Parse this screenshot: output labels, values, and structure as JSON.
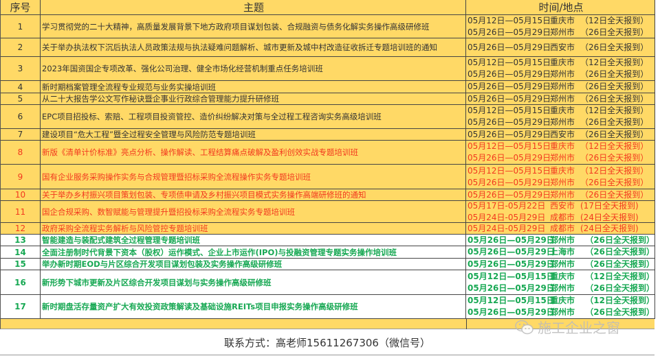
{
  "header": {
    "seq": "序号",
    "topic": "主题",
    "time": "时间/地点"
  },
  "rows": [
    {
      "no": "1",
      "style": "dark",
      "topic": "学习贯彻党的二十大精神，高质量发展背景下地方政府项目谋划包装、合规融资与债务化解实务操作高级研修班",
      "sessions": [
        {
          "date": "05月12日—05月15日",
          "city": "重庆市",
          "note": "（12日全天报到）"
        },
        {
          "date": "05月26日—05月29日",
          "city": "郑州市",
          "note": "（26日全天报到）"
        }
      ]
    },
    {
      "no": "2",
      "style": "dark",
      "topic": "关于举办执法权下沉后执法人员政策法规与执法疑难问题解析、城市更新及城中村改造征收拆迁专题培训班的通知",
      "sessions": [
        {
          "date": "05月26日—05月29日",
          "city": "西安市",
          "note": "（26日全天报到）"
        }
      ]
    },
    {
      "no": "3",
      "style": "dark",
      "topic": "2023年国资国企专项改革、强化公司治理、健全市场化经营机制重点任务培训班",
      "sessions": [
        {
          "date": "05月12日—05月15日",
          "city": "重庆市",
          "note": "（12日全天报到）"
        },
        {
          "date": "05月26日—05月29日",
          "city": "郑州市",
          "note": "（26日全天报到）"
        }
      ]
    },
    {
      "no": "4",
      "style": "dark",
      "topic": "新时期档案管理全流程专业规范与业务实操培训班",
      "sessions": [
        {
          "date": "05月26日—05月29日",
          "city": "郑州市",
          "note": "（26日全天报到）"
        }
      ]
    },
    {
      "no": "5",
      "style": "dark",
      "topic": "从二十大报告学公文写作秘诀暨企事业行政综合管理能力提升研修班",
      "sessions": [
        {
          "date": "05月26日—05月29日",
          "city": "郑州市",
          "note": "（26日全天报到）"
        }
      ]
    },
    {
      "no": "6",
      "style": "dark",
      "topic": "EPC项目招投标、索赔、工程项目投资管控、造价纠纷解决对策与全过程工程咨询实务高级培训班",
      "sessions": [
        {
          "date": "05月12日—05月15日",
          "city": "重庆市",
          "note": "（12日全天报到）"
        },
        {
          "date": "05月26日—05月29日",
          "city": "郑州市",
          "note": "（26日全天报到）"
        }
      ]
    },
    {
      "no": "7",
      "style": "dark",
      "topic": "建设项目“危大工程”暨全过程安全管理与风险防范专题培训班",
      "sessions": [
        {
          "date": "05月26日—05月29日",
          "city": "西安市",
          "note": "（26日全天报到）"
        }
      ]
    },
    {
      "no": "8",
      "style": "red",
      "topic": "新版《清单计价标准》亮点分析、操作解读、工程结算痛点破解及盈利创效实战专题培训班",
      "sessions": [
        {
          "date": "05月12日—05月15日",
          "city": "重庆市",
          "note": "（12日全天报到）"
        },
        {
          "date": "05月26日—05月29日",
          "city": "郑州市",
          "note": "（26日全天报到）"
        }
      ]
    },
    {
      "no": "9",
      "style": "red",
      "topic": "国有企业服务采购操作实务与合规管理暨招标采购全流程操作实务专题培训班",
      "sessions": [
        {
          "date": "05月12日—05月15日",
          "city": "重庆市",
          "note": "（12日全天报到）"
        },
        {
          "date": "05月26日—05月29日",
          "city": "郑州市",
          "note": "（26日全天报到）"
        }
      ]
    },
    {
      "no": "10",
      "style": "red",
      "topic": "关于举办乡村振兴项目策划包装、专项债申请及乡村振兴项目模式实务操作高端研修班的通知",
      "sessions": [
        {
          "date": "05月26日—05月29日",
          "city": "郑州市",
          "note": "（26日全天报到）"
        }
      ]
    },
    {
      "no": "11",
      "style": "red",
      "topic": "国企合规采购、数智赋能与管理提升暨招投标采购全流程实务专题培训班",
      "sessions": [
        {
          "date": "05月17日-05月22日",
          "city": "西安市",
          "note": "(17日全天报到)"
        },
        {
          "date": "05月24日-05月29日",
          "city": "成都市",
          "note": "(24日全天报到)"
        }
      ]
    },
    {
      "no": "12",
      "style": "red",
      "topic": "政府采购全流程实务解析与风险管控专题培训班",
      "sessions": [
        {
          "date": "05月24日-05月29日",
          "city": "成都市",
          "note": "(24日全天报到)"
        }
      ]
    },
    {
      "no": "13",
      "style": "green",
      "topic": "智能建造与装配式建筑全过程管理专题培训班",
      "sessions": [
        {
          "date": "05月26日—05月29日",
          "city": "郑州市",
          "note": "（26日全天报到）"
        }
      ]
    },
    {
      "no": "14",
      "style": "green",
      "topic": "全面注册制时代背景下资本（股权）运作模式、企业上市运作(IPO)与投融资管理专题实务操作培训班",
      "sessions": [
        {
          "date": "05月26日—05月29日",
          "city": "上海市",
          "note": "（26日全天报到）"
        }
      ]
    },
    {
      "no": "15",
      "style": "green",
      "topic": "举办新时期EOD与片区综合开发项目谋划包装及实务操作高级研修班",
      "sessions": [
        {
          "date": "05月26日—05月29日",
          "city": "郑州市",
          "note": "（26日全天报到）"
        }
      ]
    },
    {
      "no": "16",
      "style": "green",
      "topic": "新形势下城市更新及片区综合开发项目谋划与实务操作高级研修班",
      "sessions": [
        {
          "date": "05月12日—05月15日",
          "city": "重庆市",
          "note": "（12日全天报到）"
        },
        {
          "date": "05月26日—05月29日",
          "city": "郑州市",
          "note": "（26日全天报到）"
        }
      ]
    },
    {
      "no": "17",
      "style": "green",
      "topic": "新时期盘活存量资产扩大有效投资政策解读及基础设施REITs项目申报实务操作高级研修班",
      "sessions": [
        {
          "date": "05月12日—05月15日",
          "city": "重庆市",
          "note": "（12日全天报到）"
        },
        {
          "date": "05月26日—05月29日",
          "city": "郑州市",
          "note": "（26日全天报到）"
        }
      ]
    }
  ],
  "footer": {
    "contact": "联系方式：高老师15611267306（微信号）"
  },
  "watermark": {
    "text": "施工企业之窗"
  },
  "colors": {
    "yellow": "#FFD966",
    "red": "#F2381E",
    "green": "#17A853",
    "dark": "#333333"
  }
}
